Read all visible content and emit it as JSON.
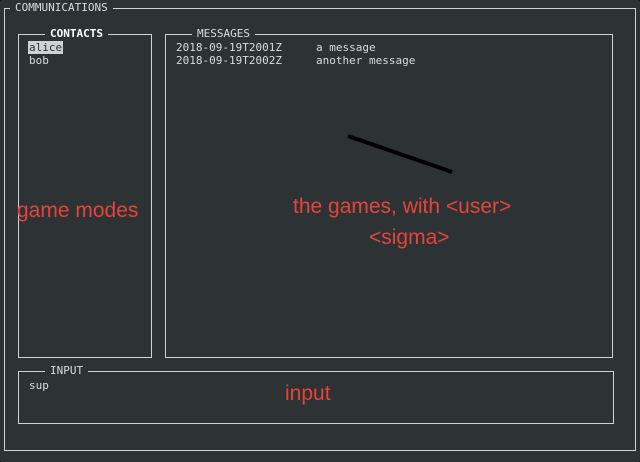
{
  "window": {
    "title": "COMMUNICATIONS"
  },
  "contacts": {
    "title": "CONTACTS",
    "items": [
      {
        "name": "alice",
        "selected": true
      },
      {
        "name": "bob",
        "selected": false
      }
    ]
  },
  "messages": {
    "title": "MESSAGES",
    "items": [
      {
        "timestamp": "2018-09-19T2001Z",
        "text": "a message"
      },
      {
        "timestamp": "2018-09-19T2002Z",
        "text": "another message"
      }
    ]
  },
  "input": {
    "title": "INPUT",
    "value": "sup"
  },
  "annotations": {
    "contacts_note": "game modes",
    "messages_note_line1": "the games, with <user>",
    "messages_note_line2": "<sigma>",
    "input_note": "input",
    "color": "#e8433b"
  },
  "colors": {
    "background": "#2d3234",
    "border": "#cfd3d4",
    "text": "#d8dcdd"
  }
}
